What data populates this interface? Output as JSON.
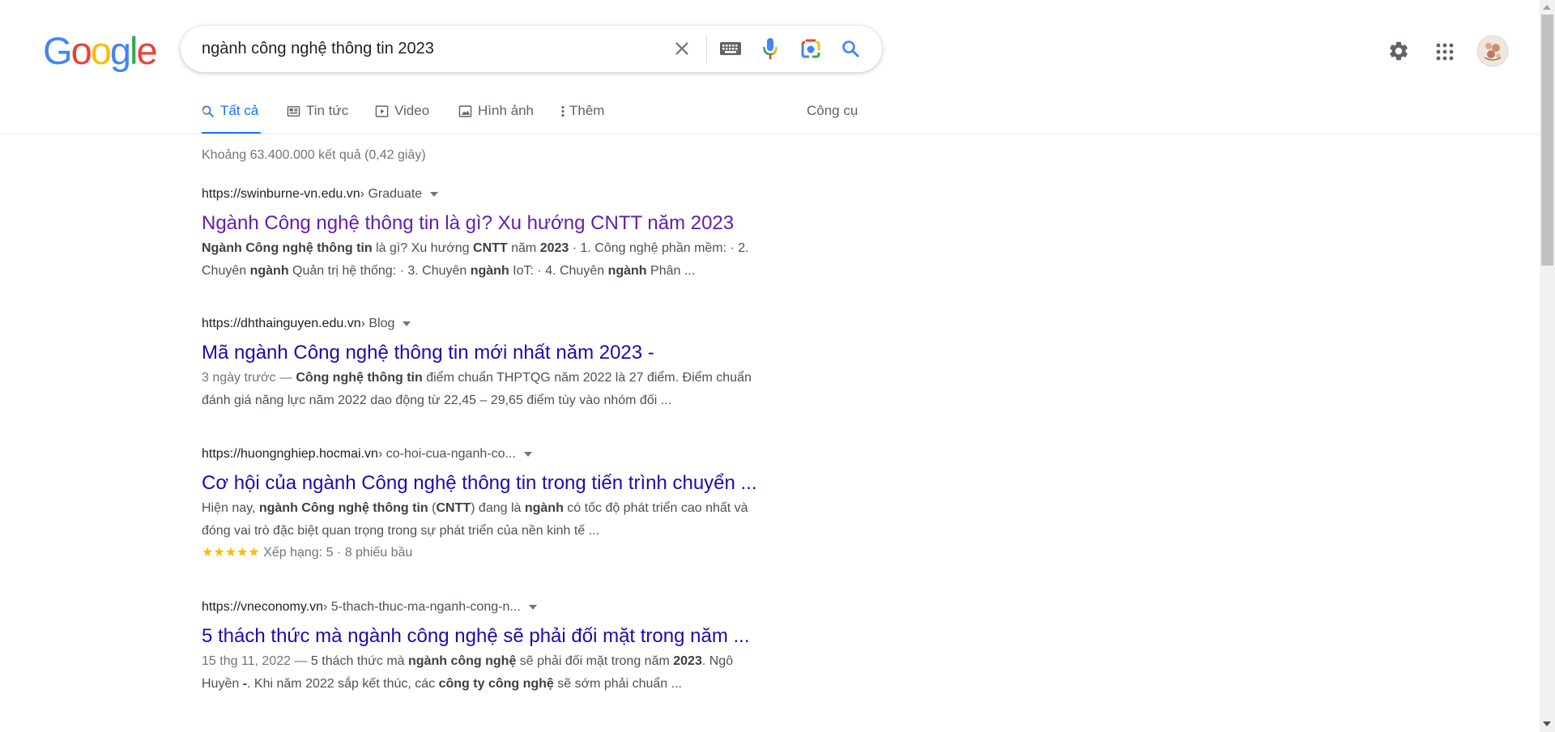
{
  "logo": {
    "letters": [
      "G",
      "o",
      "o",
      "g",
      "l",
      "e"
    ],
    "colors": [
      "#4285f4",
      "#ea4335",
      "#fbbc05",
      "#4285f4",
      "#34a853",
      "#ea4335"
    ]
  },
  "search": {
    "query": "ngành công nghệ thông tin 2023",
    "icons": [
      "close-icon",
      "keyboard-icon",
      "microphone-icon",
      "lens-camera-icon",
      "search-icon"
    ]
  },
  "header_icons": [
    "settings-gear-icon",
    "apps-grid-icon",
    "account-avatar"
  ],
  "tabs": [
    {
      "label": "Tất cả",
      "icon": "search-icon",
      "active": true
    },
    {
      "label": "Tin tức",
      "icon": "news-icon"
    },
    {
      "label": "Video",
      "icon": "video-icon"
    },
    {
      "label": "Hình ảnh",
      "icon": "image-icon"
    },
    {
      "label": "Thêm",
      "icon": "more-vertical-icon"
    }
  ],
  "tools_label": "Công cụ",
  "stats": "Khoảng 63.400.000 kết quả (0,42 giây)",
  "results": [
    {
      "site": "https://swinburne-vn.edu.vn",
      "path": " › Graduate",
      "title": "Ngành Công nghệ thông tin là gì? Xu hướng CNTT năm 2023",
      "visited": true,
      "snippet_line1": [
        {
          "t": "Ngành Công nghệ thông tin",
          "b": true
        },
        {
          "t": " là gì? Xu hướng "
        },
        {
          "t": "CNTT",
          "b": true
        },
        {
          "t": " năm "
        },
        {
          "t": "2023",
          "b": true
        },
        {
          "t": " · 1. Công nghệ phần mềm: · 2."
        }
      ],
      "snippet_line2": [
        {
          "t": "Chuyên "
        },
        {
          "t": "ngành",
          "b": true
        },
        {
          "t": " Quản trị hệ thống: · 3. Chuyên "
        },
        {
          "t": "ngành",
          "b": true
        },
        {
          "t": " IoT: · 4. Chuyên "
        },
        {
          "t": "ngành",
          "b": true
        },
        {
          "t": " Phân ..."
        }
      ]
    },
    {
      "site": "https://dhthainguyen.edu.vn",
      "path": " › Blog",
      "title": "Mã ngành Công nghệ thông tin mới nhất năm 2023 -",
      "visited": false,
      "snippet_line1": [
        {
          "t": "3 ngày trước — ",
          "d": true
        },
        {
          "t": "Công nghệ thông tin",
          "b": true
        },
        {
          "t": " điểm chuẩn THPTQG năm 2022 là 27 điểm. Điểm chuẩn"
        }
      ],
      "snippet_line2": [
        {
          "t": "đánh giá năng lực năm 2022 dao động từ 22,45 – 29,65 điểm tùy vào nhóm đối ..."
        }
      ]
    },
    {
      "site": "https://huongnghiep.hocmai.vn",
      "path": " › co-hoi-cua-nganh-co...",
      "title": "Cơ hội của ngành Công nghệ thông tin trong tiến trình chuyển ...",
      "visited": false,
      "snippet_line1": [
        {
          "t": "Hiện nay, "
        },
        {
          "t": "ngành Công nghệ thông tin",
          "b": true
        },
        {
          "t": " ("
        },
        {
          "t": "CNTT",
          "b": true
        },
        {
          "t": ") đang là "
        },
        {
          "t": "ngành",
          "b": true
        },
        {
          "t": " có tốc độ phát triển cao nhất và"
        }
      ],
      "snippet_line2": [
        {
          "t": "đóng vai trò đặc biệt quan trọng trong sự phát triển của nền kinh tế ..."
        }
      ],
      "rating": {
        "stars": "★★★★★",
        "text": "Xếp hạng: 5 · 8 phiếu bầu",
        "value": 5
      }
    },
    {
      "site": "https://vneconomy.vn",
      "path": " › 5-thach-thuc-ma-nganh-cong-n...",
      "title": "5 thách thức mà ngành công nghệ sẽ phải đối mặt trong năm ...",
      "visited": false,
      "snippet_line1": [
        {
          "t": "15 thg 11, 2022 — ",
          "d": true
        },
        {
          "t": "5 thách thức mà "
        },
        {
          "t": "ngành công nghệ",
          "b": true
        },
        {
          "t": " sẽ phải đối mặt trong năm "
        },
        {
          "t": "2023",
          "b": true
        },
        {
          "t": ". Ngô"
        }
      ],
      "snippet_line2": [
        {
          "t": "Huyền "
        },
        {
          "t": "-",
          "b": true
        },
        {
          "t": ". Khi năm 2022 sắp kết thúc, các "
        },
        {
          "t": "công ty công nghệ",
          "b": true
        },
        {
          "t": " sẽ sớm phải chuẩn ..."
        }
      ]
    }
  ]
}
